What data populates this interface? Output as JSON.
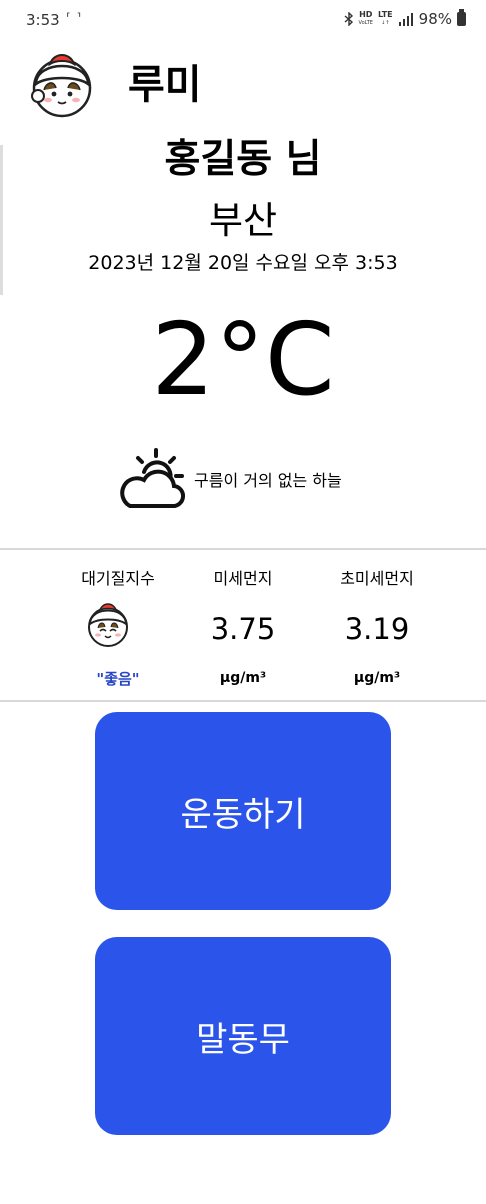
{
  "status_bar": {
    "time": "3:53",
    "screenshot_glyph": "⸢ ⸣",
    "hd_label": "HD",
    "hd_sub": "VoLTE",
    "lte_label": "LTE",
    "battery": "98%"
  },
  "header": {
    "app_name": "루미",
    "username": "홍길동 님",
    "city": "부산",
    "datetime": "2023년 12월 20일 수요일 오후 3:53"
  },
  "weather": {
    "temperature": "2°C",
    "description": "구름이 거의 없는 하늘",
    "icon": "sun-behind-cloud-icon"
  },
  "air_quality": {
    "aqi_label": "대기질지수",
    "aqi_grade": "\"좋음\"",
    "pm10_label": "미세먼지",
    "pm10_value": "3.75",
    "pm10_unit": "μg/m³",
    "pm25_label": "초미세먼지",
    "pm25_value": "3.19",
    "pm25_unit": "μg/m³"
  },
  "buttons": {
    "exercise": "운동하기",
    "talk": "말동무"
  },
  "colors": {
    "button_blue": "#2b54ea",
    "grade_blue": "#2745c4"
  }
}
